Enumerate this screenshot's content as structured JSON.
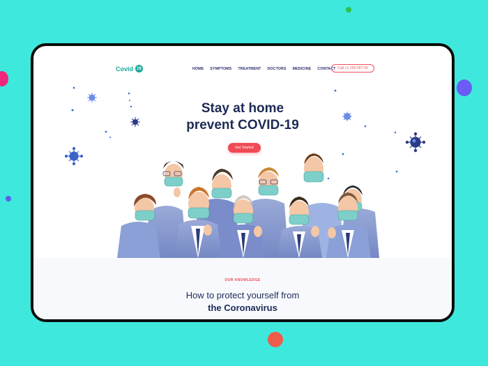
{
  "header": {
    "logo_text": "Covid",
    "logo_badge": "19",
    "nav": [
      "HOME",
      "SYMPTOMS",
      "TREATMENT",
      "DOCTORS",
      "MEDICINE",
      "CONTACT"
    ],
    "call": "Call +1 250 567 50"
  },
  "hero": {
    "title_line1": "Stay at home",
    "title_line2": "prevent COVID-19",
    "cta": "Get Started"
  },
  "section": {
    "eyebrow": "OUR KNOWLEDGE",
    "title_line1": "How to protect yourself from",
    "title_line2": "the Coronavirus"
  },
  "colors": {
    "background": "#3fe8dc",
    "accent": "#ef4a55",
    "brand": "#1aa99b",
    "navy": "#1d2a55",
    "mask": "#7ecfc9",
    "suit": "#8a9cd0"
  }
}
